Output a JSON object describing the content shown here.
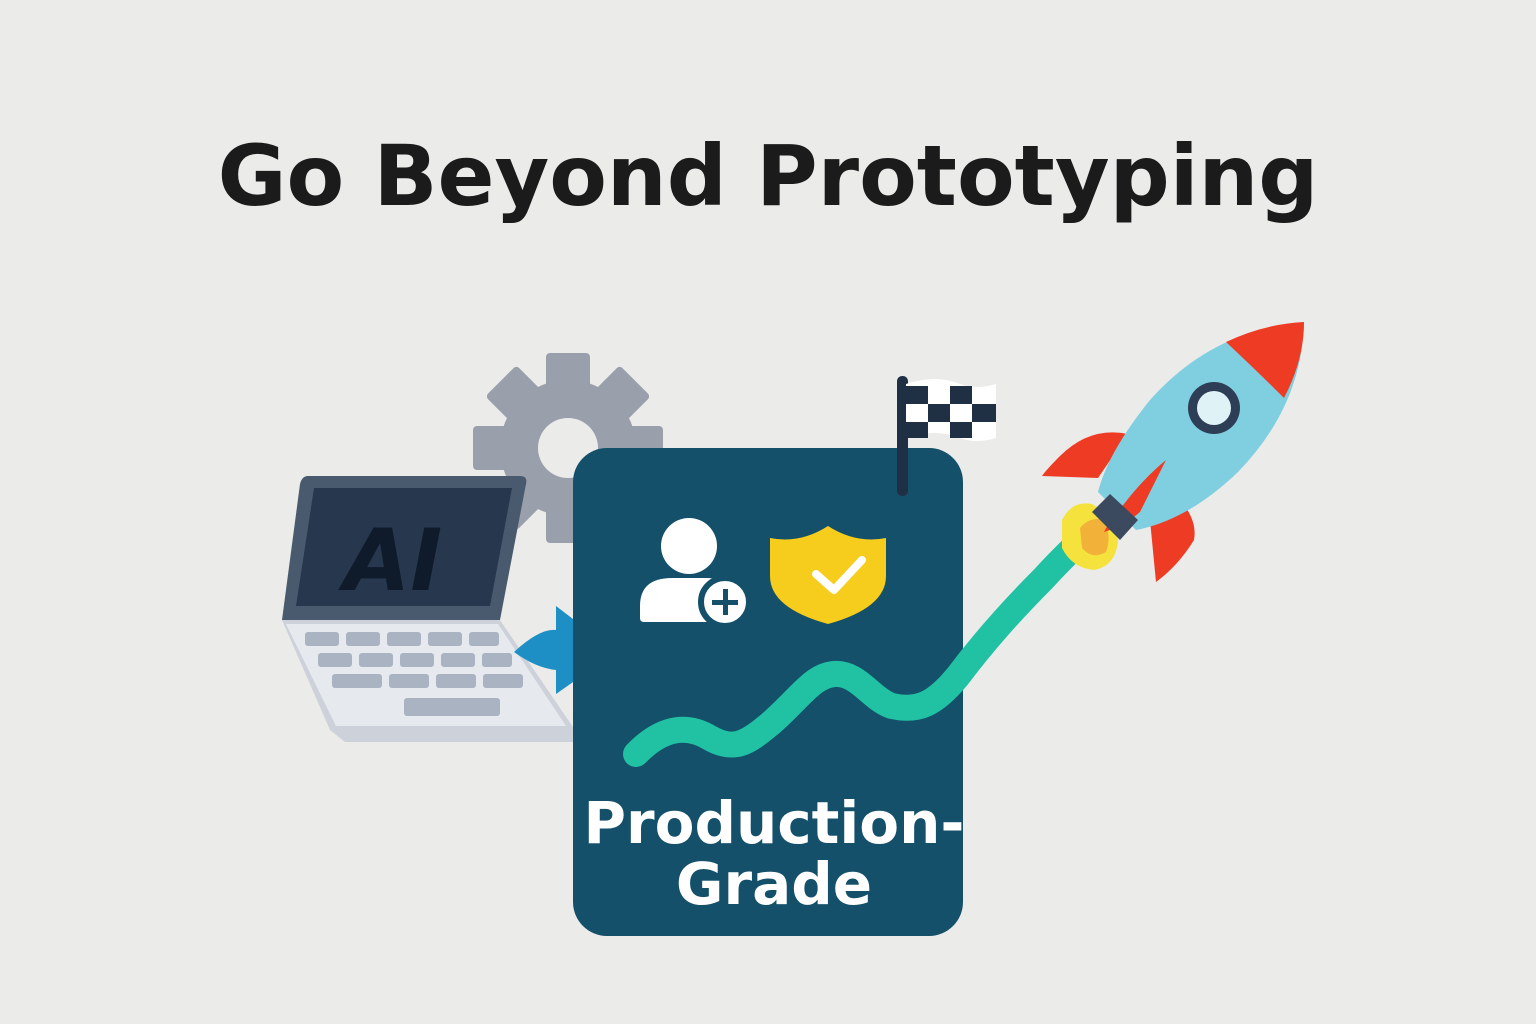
{
  "headline": "Go Beyond Prototyping",
  "laptop": {
    "screen_text": "AI"
  },
  "card": {
    "label_line1": "Production-",
    "label_line2": "Grade"
  },
  "icons": {
    "gear": "gear-icon",
    "laptop": "laptop-icon",
    "arrow": "arrow-right-icon",
    "add_user": "add-user-icon",
    "shield": "shield-check-icon",
    "flag": "checkered-flag-icon",
    "rocket": "rocket-icon",
    "growth_line": "growth-line-icon"
  },
  "colors": {
    "background": "#ebebea",
    "card": "#145069",
    "growth_line": "#21c2a4",
    "shield": "#f6cc1d",
    "rocket_body": "#7fcfe0",
    "rocket_fins": "#ee3b24",
    "gear": "#9aa0ab",
    "arrow": "#1d8fc5"
  }
}
